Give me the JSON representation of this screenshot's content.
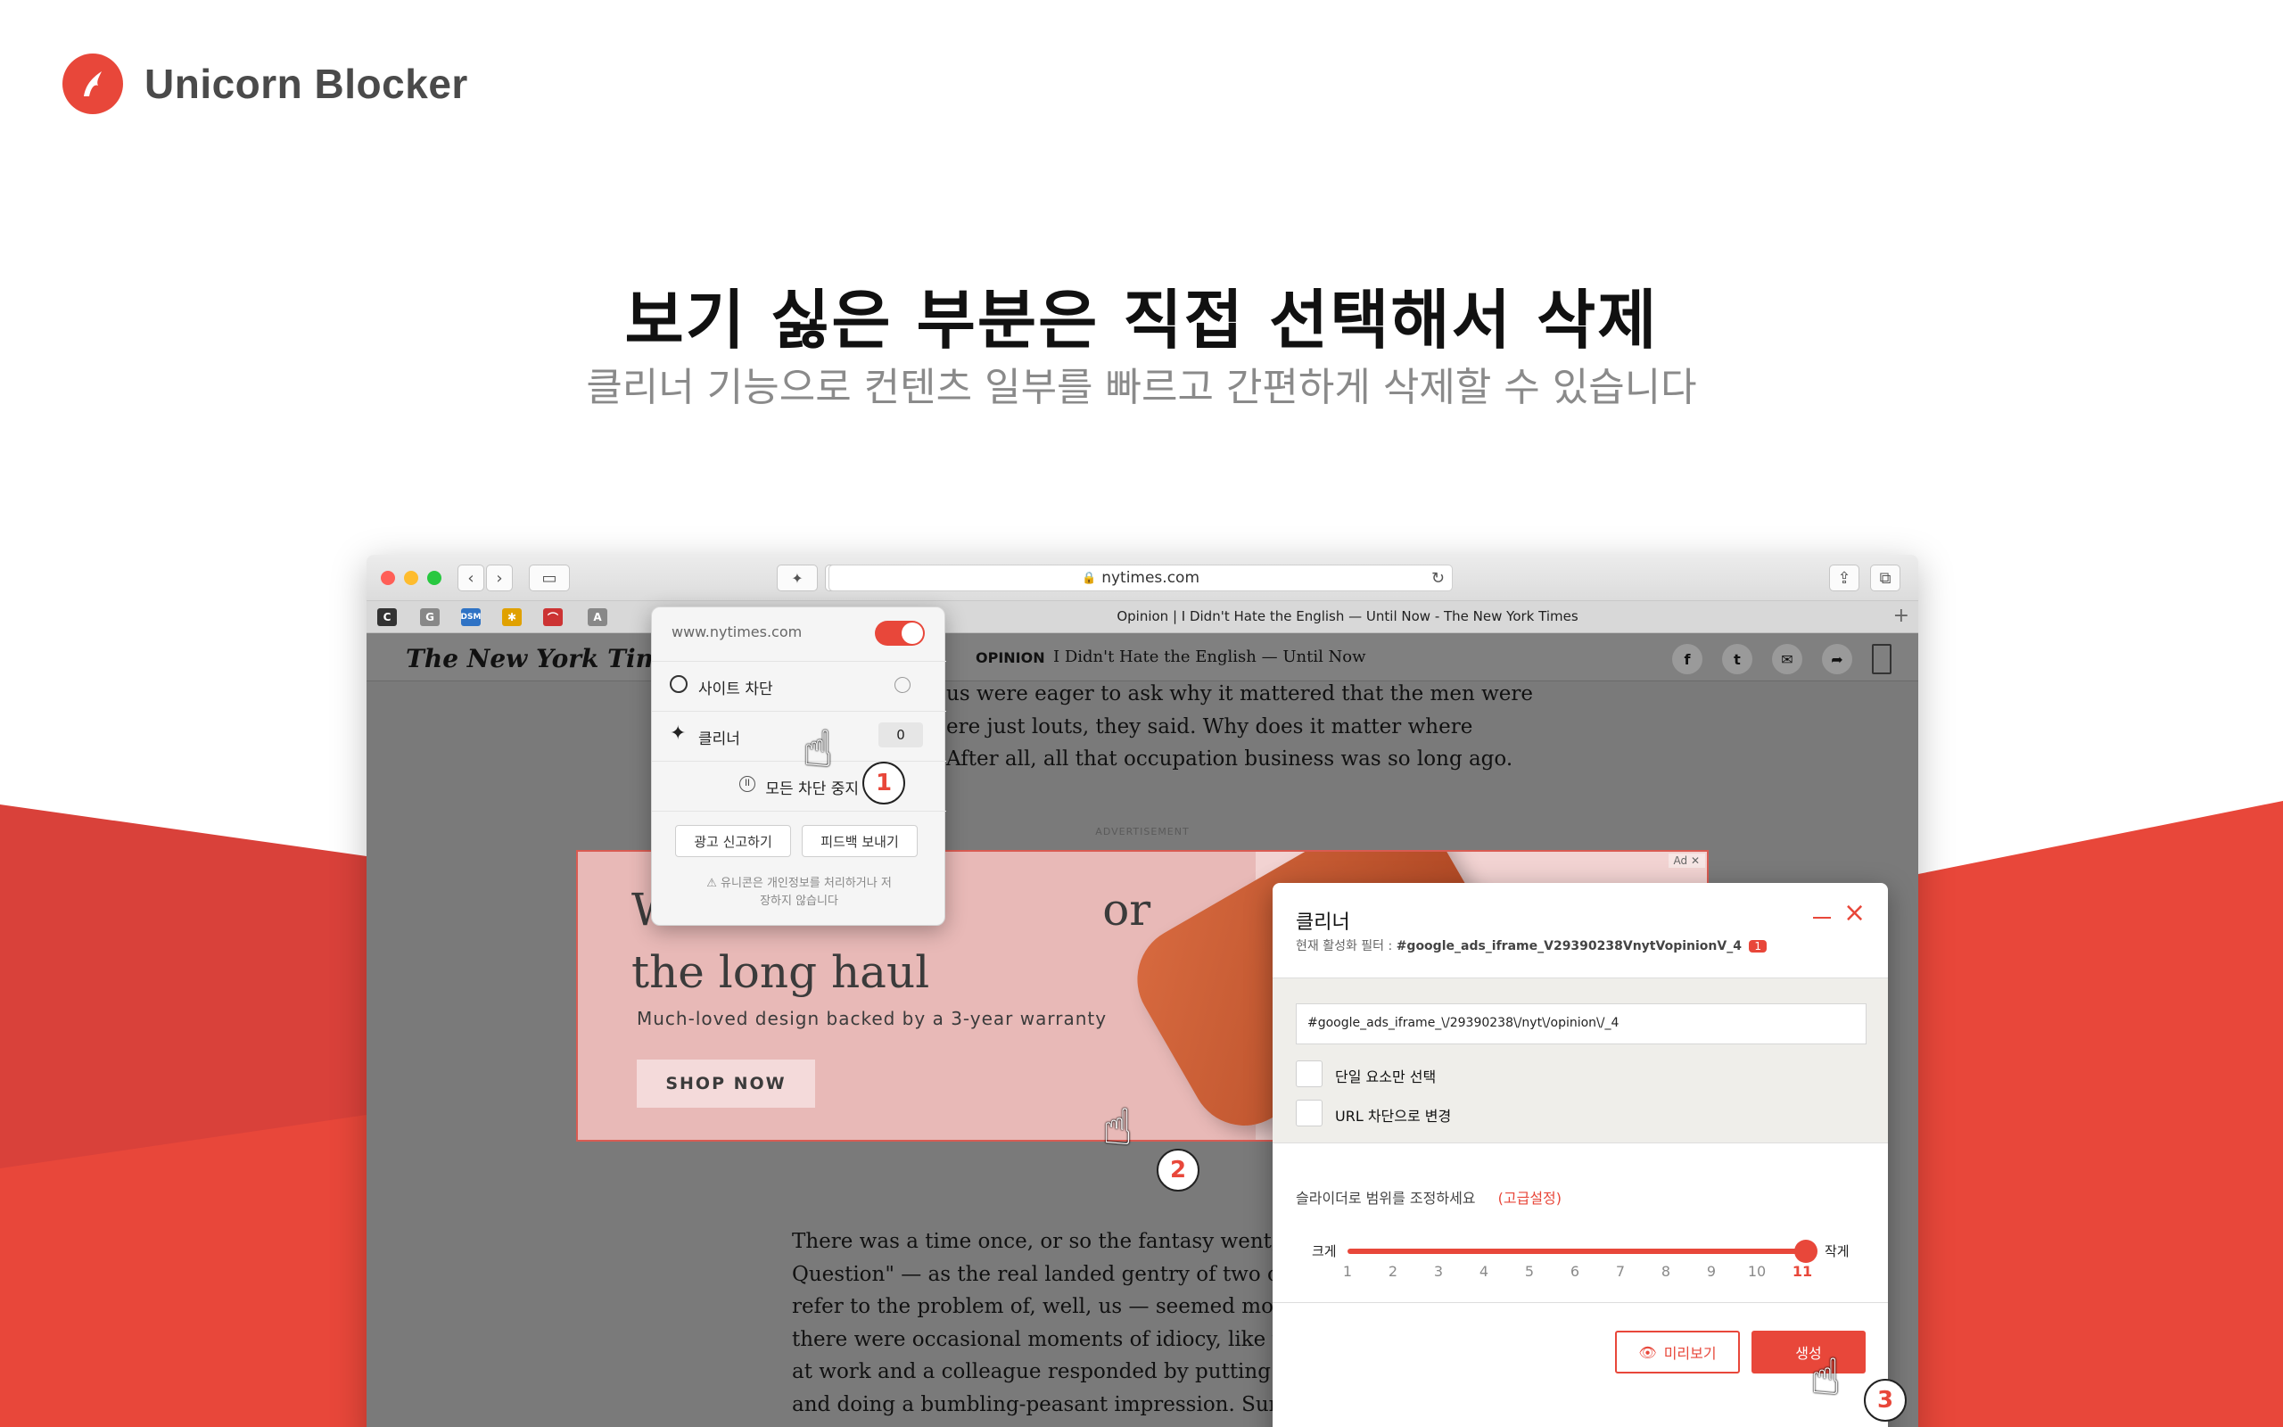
{
  "brand": {
    "name": "Unicorn Blocker",
    "accent": "#e8473a"
  },
  "hero": {
    "title": "보기 싫은 부분은 직접 선택해서 삭제",
    "subtitle": "클리너 기능으로 컨텐츠 일부를 빠르고 간편하게 삭제할 수 있습니다"
  },
  "browser": {
    "url": "nytimes.com",
    "tab_title": "Opinion | I Didn't Hate the English — Until Now - The New York Times",
    "favicons": [
      "C",
      "G",
      "DSM",
      "A"
    ]
  },
  "nyt": {
    "logo": "The New York Times",
    "section": "OPINION",
    "article_title": "I Didn't Hate the English — Until Now",
    "top_lines": [
      "us were eager to ask why it mattered that the men were",
      "ere just louts, they said. Why does it matter where",
      "After all, all that occupation business was so long ago."
    ],
    "bottom_lines": [
      "There was a time once, or so the fantasy went, wh",
      "Question\" — as the real landed gentry of two cent",
      "refer to the problem of, well, us — seemed more c",
      "there were occasional moments of idiocy, like whe",
      "at work and a colleague responded by putting on",
      "and doing a bumbling-peasant impression. Sure, the English still loved"
    ]
  },
  "ad": {
    "label": "ADVERTISEMENT",
    "tag": "Ad ✕",
    "title_line1": "W                              or",
    "title_line2": "the long haul",
    "subtitle": "Much-loved design backed by a 3-year warranty",
    "button": "SHOP NOW"
  },
  "popover": {
    "domain": "www.nytimes.com",
    "site_block": "사이트 차단",
    "cleaner": "클리너",
    "cleaner_count": "0",
    "pause_all": "모든 차단 중지",
    "report_ad": "광고 신고하기",
    "send_feedback": "피드백 보내기",
    "privacy_note_1": "⚠ 유니콘은 개인정보를 처리하거나 저",
    "privacy_note_2": "장하지 않습니다"
  },
  "cleaner_panel": {
    "title": "클리너",
    "filter_label": "현재 활성화 필터 : ",
    "filter_value": "#google_ads_iframe_V29390238VnytVopinionV_4",
    "filter_count": "1",
    "selector_value": "#google_ads_iframe_\\/29390238\\/nyt\\/opinion\\/_4",
    "single_only": "단일 요소만 선택",
    "url_block": "URL 차단으로 변경",
    "slider_hint": "슬라이더로 범위를 조정하세요",
    "advanced": "(고급설정)",
    "left_label": "크게",
    "right_label": "작게",
    "slider_value": 11,
    "ticks": [
      "1",
      "2",
      "3",
      "4",
      "5",
      "6",
      "7",
      "8",
      "9",
      "10",
      "11"
    ],
    "preview": "미리보기",
    "create": "생성"
  },
  "steps": [
    "1",
    "2",
    "3"
  ]
}
